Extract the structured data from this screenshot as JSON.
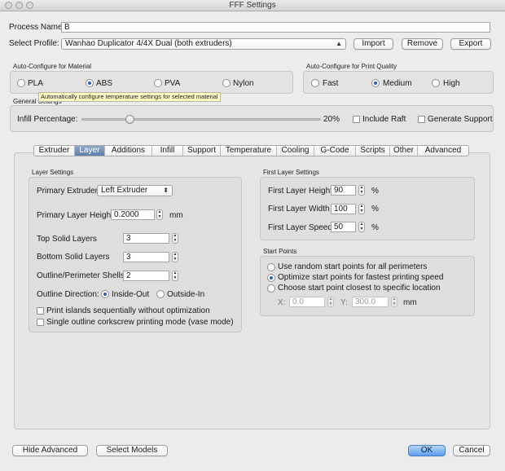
{
  "window": {
    "title": "FFF Settings"
  },
  "process": {
    "label": "Process Name:",
    "value": "B"
  },
  "profile": {
    "label": "Select Profile:",
    "value": "Wanhao Duplicator 4/4X Dual (both extruders)",
    "import_label": "Import",
    "remove_label": "Remove",
    "export_label": "Export"
  },
  "material": {
    "title": "Auto-Configure for Material",
    "options": [
      "PLA",
      "ABS",
      "PVA",
      "Nylon"
    ],
    "selected": "ABS",
    "tooltip": "Automatically configure temperature settings for selected material"
  },
  "quality": {
    "title": "Auto-Configure for Print Quality",
    "options": [
      "Fast",
      "Medium",
      "High"
    ],
    "selected": "Medium"
  },
  "general": {
    "title": "General Settings",
    "infill_label": "Infill Percentage:",
    "infill_value": "20%",
    "infill_fraction": 0.2,
    "raft_label": "Include Raft",
    "support_label": "Generate Support"
  },
  "tabs": [
    "Extruder",
    "Layer",
    "Additions",
    "Infill",
    "Support",
    "Temperature",
    "Cooling",
    "G-Code",
    "Scripts",
    "Other",
    "Advanced"
  ],
  "active_tab": "Layer",
  "layer_settings": {
    "title": "Layer Settings",
    "primary_extruder_label": "Primary Extruder",
    "primary_extruder_value": "Left Extruder",
    "primary_layer_height_label": "Primary Layer Height",
    "primary_layer_height_value": "0.2000",
    "mm_unit": "mm",
    "top_solid_label": "Top Solid Layers",
    "top_solid_value": "3",
    "bottom_solid_label": "Bottom Solid Layers",
    "bottom_solid_value": "3",
    "outline_shells_label": "Outline/Perimeter Shells",
    "outline_shells_value": "2",
    "outline_direction_label": "Outline Direction:",
    "inside_out_label": "Inside-Out",
    "outside_in_label": "Outside-In",
    "islands_label": "Print islands sequentially without optimization",
    "vase_label": "Single outline corkscrew printing mode (vase mode)"
  },
  "first_layer": {
    "title": "First Layer Settings",
    "height_label": "First Layer Height",
    "height_value": "90",
    "width_label": "First Layer Width",
    "width_value": "100",
    "speed_label": "First Layer Speed",
    "speed_value": "50",
    "percent_unit": "%"
  },
  "start_points": {
    "title": "Start Points",
    "random_label": "Use random start points for all perimeters",
    "optimize_label": "Optimize start points for fastest printing speed",
    "closest_label": "Choose start point closest to specific location",
    "x_label": "X:",
    "x_value": "0.0",
    "y_label": "Y:",
    "y_value": "300.0",
    "mm_unit": "mm"
  },
  "footer": {
    "hide_advanced_label": "Hide Advanced",
    "select_models_label": "Select Models",
    "ok_label": "OK",
    "cancel_label": "Cancel"
  },
  "icons": {
    "stepper": "stepper-arrows-icon",
    "select_arrows": "updown-arrows-icon"
  },
  "colors": {
    "accent": "#5d9ef0",
    "tab_active": "#6f8db3",
    "tooltip_bg": "#fdfdc6"
  }
}
